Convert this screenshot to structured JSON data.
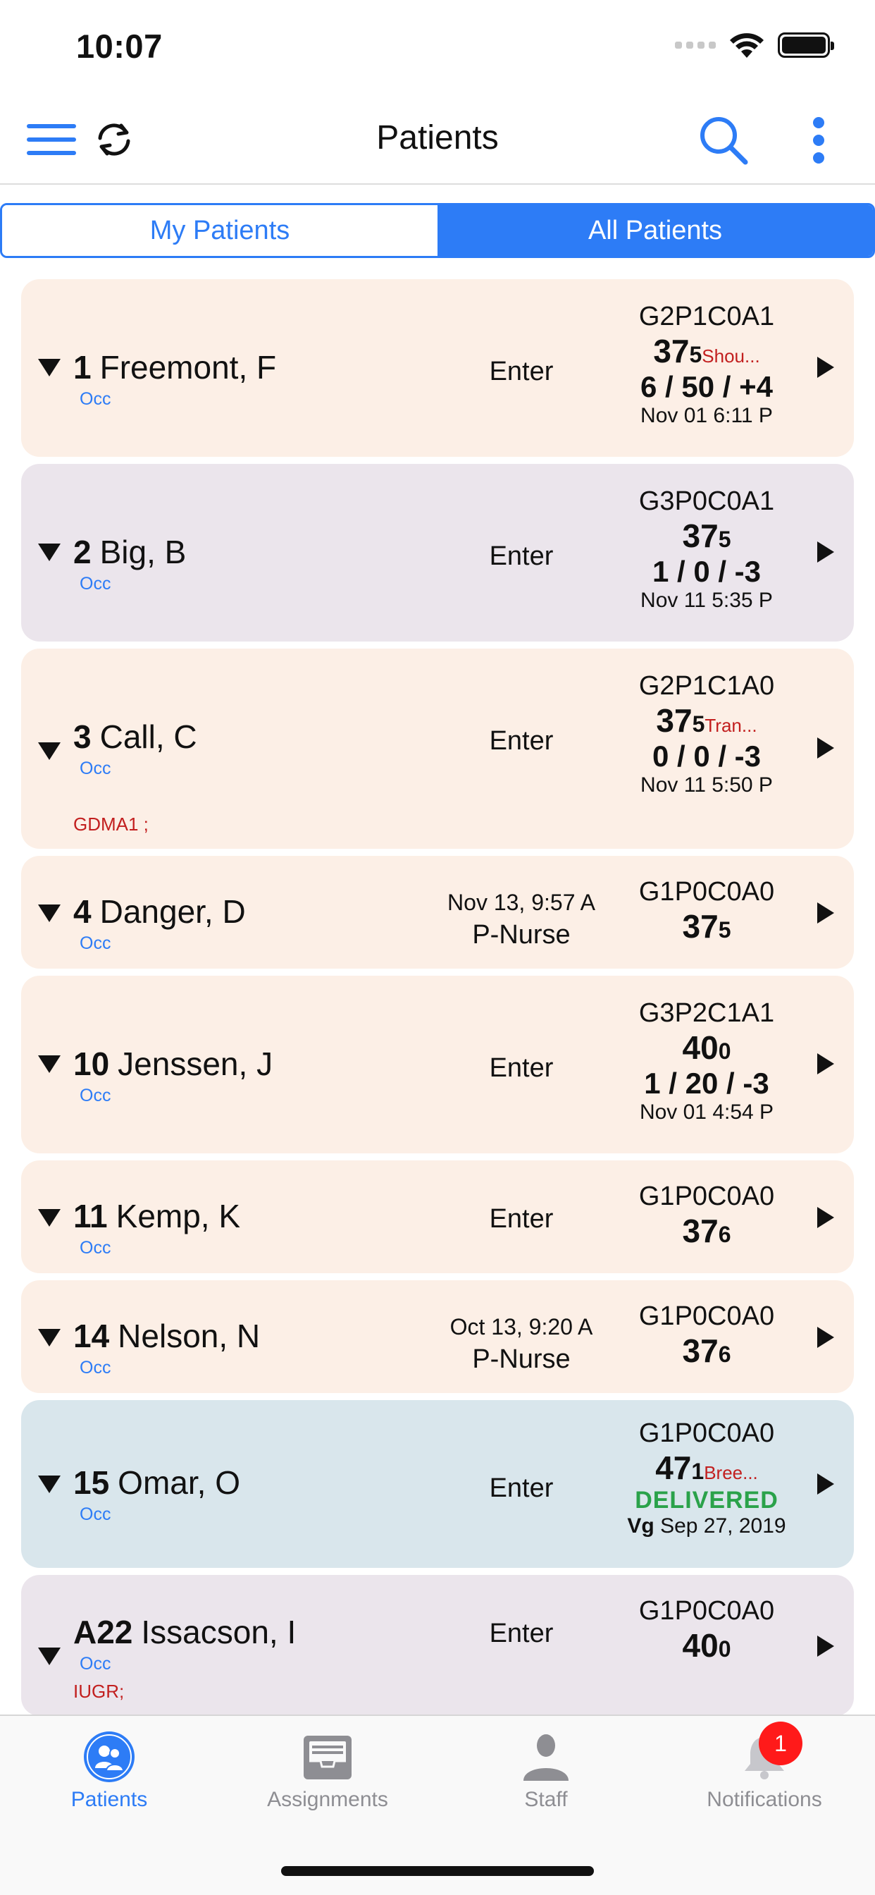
{
  "status_bar": {
    "time": "10:07"
  },
  "nav": {
    "title": "Patients"
  },
  "segments": {
    "my_patients": "My Patients",
    "all_patients": "All Patients"
  },
  "patients": [
    {
      "num": "1",
      "name": "Freemont, F",
      "occ": "Occ",
      "diag": "",
      "date": "",
      "action": "Enter",
      "gpal": "G2P1C0A1",
      "ga_weeks": "37",
      "ga_days": "5",
      "ga_note": "Shou...",
      "dilation": "6 / 50 / +4",
      "timestamp": "Nov 01 6:11 P",
      "color": "#fcefe6"
    },
    {
      "num": "2",
      "name": "Big, B",
      "occ": "Occ",
      "diag": "",
      "date": "",
      "action": "Enter",
      "gpal": "G3P0C0A1",
      "ga_weeks": "37",
      "ga_days": "5",
      "ga_note": "",
      "dilation": "1 / 0 / -3",
      "timestamp": "Nov 11 5:35 P",
      "color": "#ebe5ec"
    },
    {
      "num": "3",
      "name": "Call, C",
      "occ": "Occ",
      "diag": "GDMA1 ;",
      "date": "",
      "action": "Enter",
      "gpal": "G2P1C1A0",
      "ga_weeks": "37",
      "ga_days": "5",
      "ga_note": "Tran...",
      "dilation": "0 / 0 / -3",
      "timestamp": "Nov 11 5:50 P",
      "color": "#fcefe6"
    },
    {
      "num": "4",
      "name": "Danger, D",
      "occ": "Occ",
      "diag": "",
      "date": "Nov 13, 9:57 A",
      "action": "P-Nurse",
      "gpal": "G1P0C0A0",
      "ga_weeks": "37",
      "ga_days": "5",
      "ga_note": "",
      "dilation": "",
      "timestamp": "",
      "color": "#fcefe6"
    },
    {
      "num": "10",
      "name": "Jenssen, J",
      "occ": "Occ",
      "diag": "",
      "date": "",
      "action": "Enter",
      "gpal": "G3P2C1A1",
      "ga_weeks": "40",
      "ga_days": "0",
      "ga_note": "",
      "dilation": "1 / 20 / -3",
      "timestamp": "Nov 01 4:54 P",
      "color": "#fcefe6"
    },
    {
      "num": "11",
      "name": "Kemp, K",
      "occ": "Occ",
      "diag": "",
      "date": "",
      "action": "Enter",
      "gpal": "G1P0C0A0",
      "ga_weeks": "37",
      "ga_days": "6",
      "ga_note": "",
      "dilation": "",
      "timestamp": "",
      "color": "#fcefe6"
    },
    {
      "num": "14",
      "name": "Nelson, N",
      "occ": "Occ",
      "diag": "",
      "date": "Oct 13, 9:20 A",
      "action": "P-Nurse",
      "gpal": "G1P0C0A0",
      "ga_weeks": "37",
      "ga_days": "6",
      "ga_note": "",
      "dilation": "",
      "timestamp": "",
      "color": "#fcefe6"
    },
    {
      "num": "15",
      "name": "Omar, O",
      "occ": "Occ",
      "diag": "",
      "date": "",
      "action": "Enter",
      "gpal": "G1P0C0A0",
      "ga_weeks": "47",
      "ga_days": "1",
      "ga_note": "Bree...",
      "status": "DELIVERED",
      "ts_prefix": "Vg",
      "timestamp": "Sep 27, 2019",
      "color": "#d9e6ec"
    },
    {
      "num": "A22",
      "name": "Issacson, I",
      "occ": "Occ",
      "diag": "IUGR;",
      "date": "",
      "action": "Enter",
      "gpal": "G1P0C0A0",
      "ga_weeks": "40",
      "ga_days": "0",
      "ga_note": "",
      "dilation": "",
      "timestamp": "",
      "color": "#ebe5ec"
    }
  ],
  "tabs": {
    "patients": "Patients",
    "assignments": "Assignments",
    "staff": "Staff",
    "notifications": "Notifications",
    "notifications_badge": "1"
  },
  "colors": {
    "accent": "#2d7cf6",
    "alert": "#c21f1f",
    "delivered": "#2aa24a",
    "badge": "#ff1a1a"
  }
}
